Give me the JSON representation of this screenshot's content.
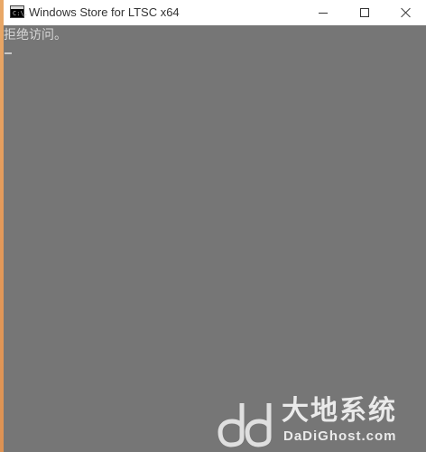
{
  "window": {
    "title": "Windows Store for LTSC x64",
    "icon": "console-icon",
    "icon_prompt": "C:\\."
  },
  "console": {
    "lines": [
      "拒绝访问。"
    ]
  },
  "watermark": {
    "brand_cn": "大地系统",
    "brand_en": "DaDiGhost.com"
  },
  "colors": {
    "console_bg": "#767676",
    "console_text": "#d6d6d6",
    "titlebar_bg": "#ffffff",
    "desktop_accent": "#e3995a"
  }
}
